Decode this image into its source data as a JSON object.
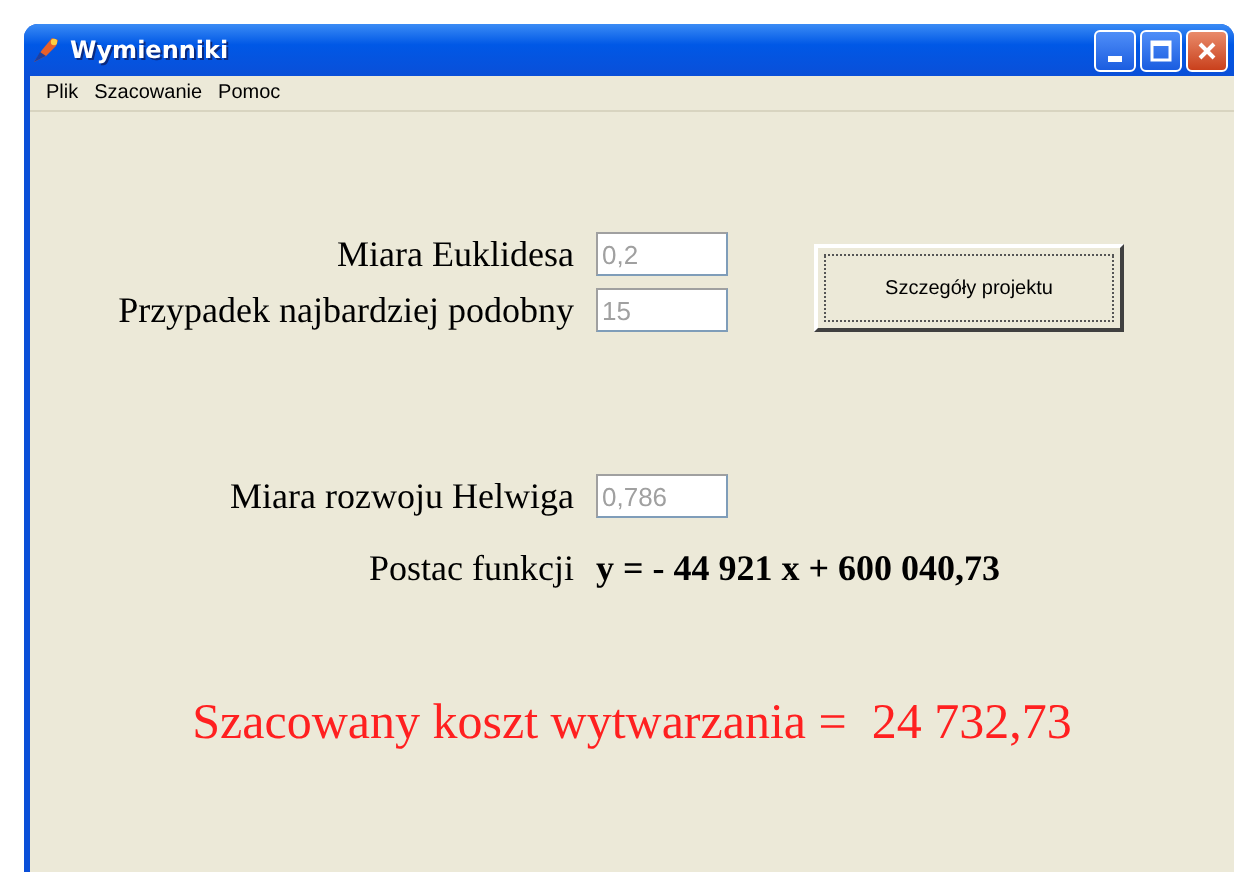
{
  "window": {
    "title": "Wymienniki"
  },
  "menu": [
    {
      "label": "Plik"
    },
    {
      "label": "Szacowanie"
    },
    {
      "label": "Pomoc"
    }
  ],
  "fields": [
    {
      "label": "Miara Euklidesa",
      "value": "0,2",
      "disabled": true
    },
    {
      "label": "Przypadek najbardziej podobny",
      "value": "15",
      "disabled": true
    }
  ],
  "details_button": {
    "label": "Szczegóły projektu"
  },
  "helwig": {
    "label": "Miara rozwoju Helwiga",
    "value": "0,786",
    "disabled": true
  },
  "function": {
    "label": "Postac funkcji",
    "formula": "y = - 44 921 x + 600 040,73"
  },
  "result": {
    "text": "Szacowany koszt wytwarzania =  24 732,73"
  }
}
